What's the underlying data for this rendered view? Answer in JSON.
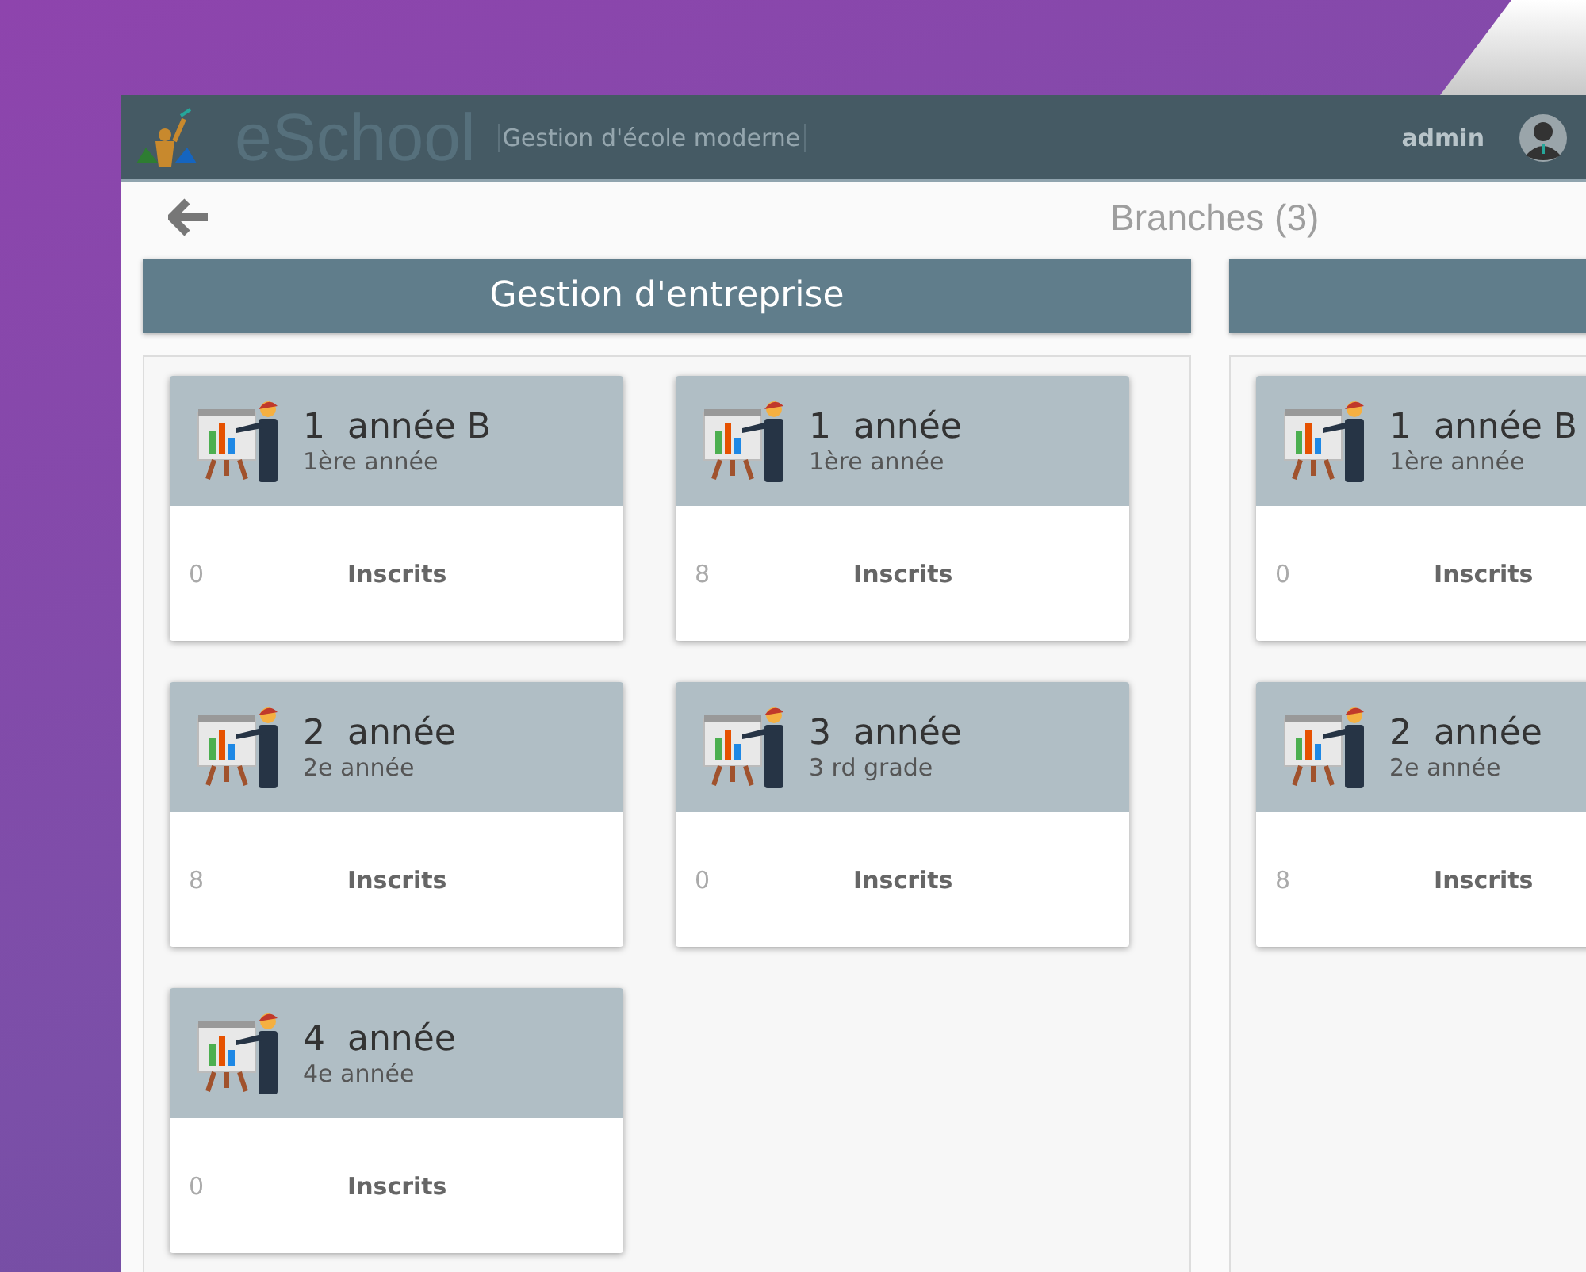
{
  "header": {
    "brand": "eSchool",
    "tagline": "Gestion d'école moderne",
    "user": "admin"
  },
  "page_title": "Branches (3)",
  "branches": [
    {
      "title": "Gestion d'entreprise",
      "classes": [
        {
          "name": "1  année B",
          "level_name": "1ère année",
          "count": "0",
          "count_label": "Inscrits"
        },
        {
          "name": "1  année",
          "level_name": "1ère année",
          "count": "8",
          "count_label": "Inscrits"
        },
        {
          "name": "2  année",
          "level_name": "2e année",
          "count": "8",
          "count_label": "Inscrits"
        },
        {
          "name": "3  année",
          "level_name": "3 rd grade",
          "count": "0",
          "count_label": "Inscrits"
        },
        {
          "name": "4  année",
          "level_name": "4e année",
          "count": "0",
          "count_label": "Inscrits"
        }
      ]
    },
    {
      "classes": [
        {
          "name": "1  année B",
          "level_name": "1ère année",
          "count": "0",
          "count_label": "Inscrits"
        },
        {
          "name": "2  année",
          "level_name": "2e année",
          "count": "8",
          "count_label": "Inscrits"
        }
      ]
    }
  ]
}
